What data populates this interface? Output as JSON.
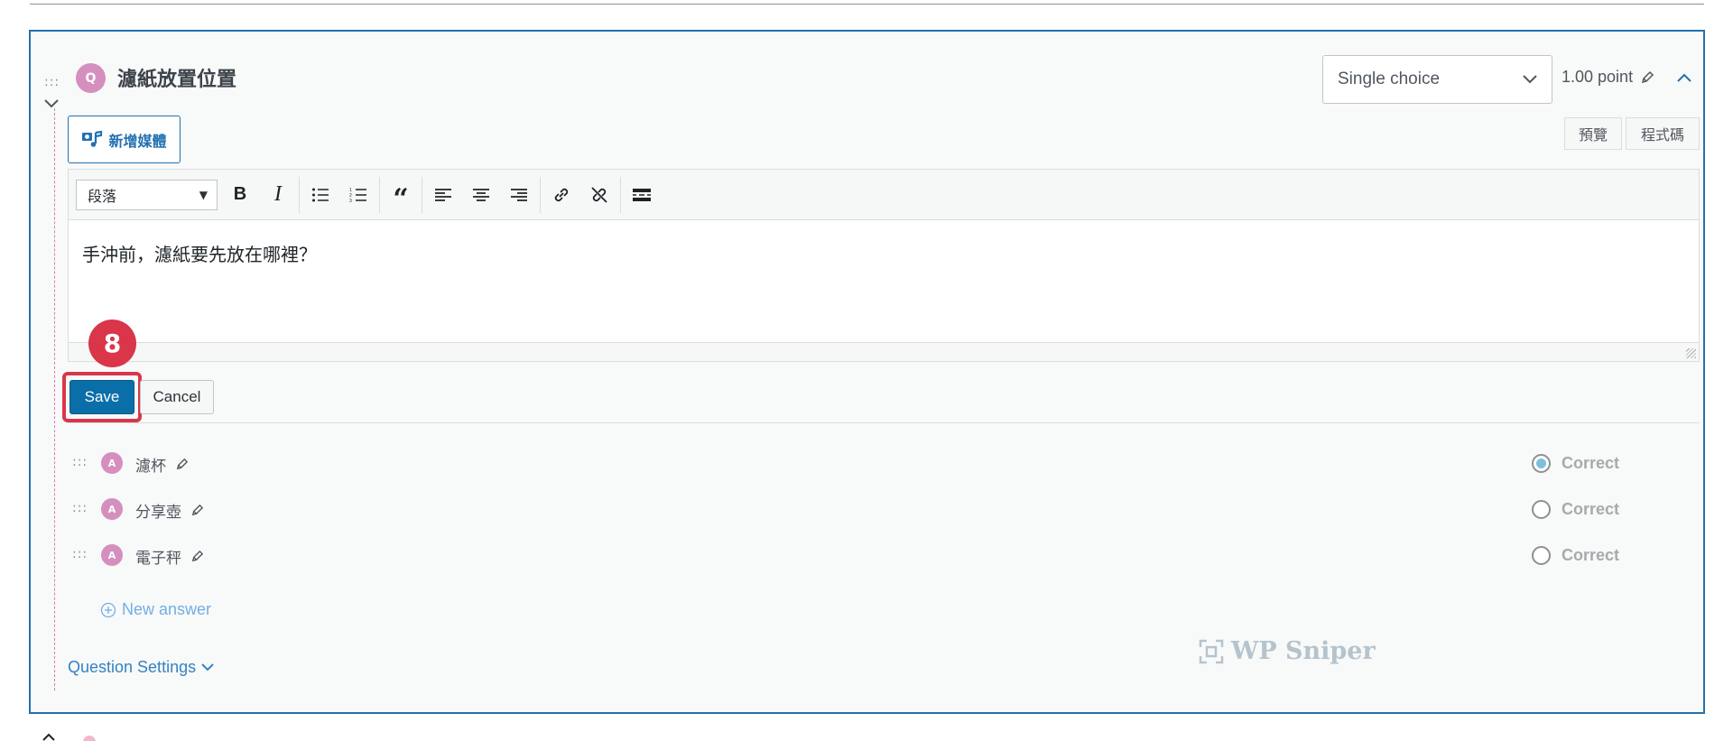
{
  "question": {
    "badge": "Q",
    "title": "濾紙放置位置",
    "type": "Single choice",
    "points": "1.00 point"
  },
  "media_button": "新增媒體",
  "editor_tabs": {
    "visual": "預覽",
    "code": "程式碼"
  },
  "editor": {
    "format": "段落",
    "content": "手沖前，濾紙要先放在哪裡？",
    "toolbar_icons": [
      "bold-icon",
      "italic-icon",
      "bullet-list-icon",
      "numbered-list-icon",
      "blockquote-icon",
      "align-left-icon",
      "align-center-icon",
      "align-right-icon",
      "link-icon",
      "unlink-icon",
      "more-tag-icon"
    ]
  },
  "step_marker": "8",
  "actions": {
    "save": "Save",
    "cancel": "Cancel"
  },
  "answers": [
    {
      "badge": "A",
      "text": "濾杯",
      "correct_label": "Correct",
      "selected": true
    },
    {
      "badge": "A",
      "text": "分享壺",
      "correct_label": "Correct",
      "selected": false
    },
    {
      "badge": "A",
      "text": "電子秤",
      "correct_label": "Correct",
      "selected": false
    }
  ],
  "new_answer": "New answer",
  "question_settings": "Question Settings",
  "watermark": "WP Sniper",
  "colors": {
    "accent": "#2271b1",
    "save": "#0a6ea8",
    "marker": "#d9364a",
    "badge": "#d58fbe"
  }
}
